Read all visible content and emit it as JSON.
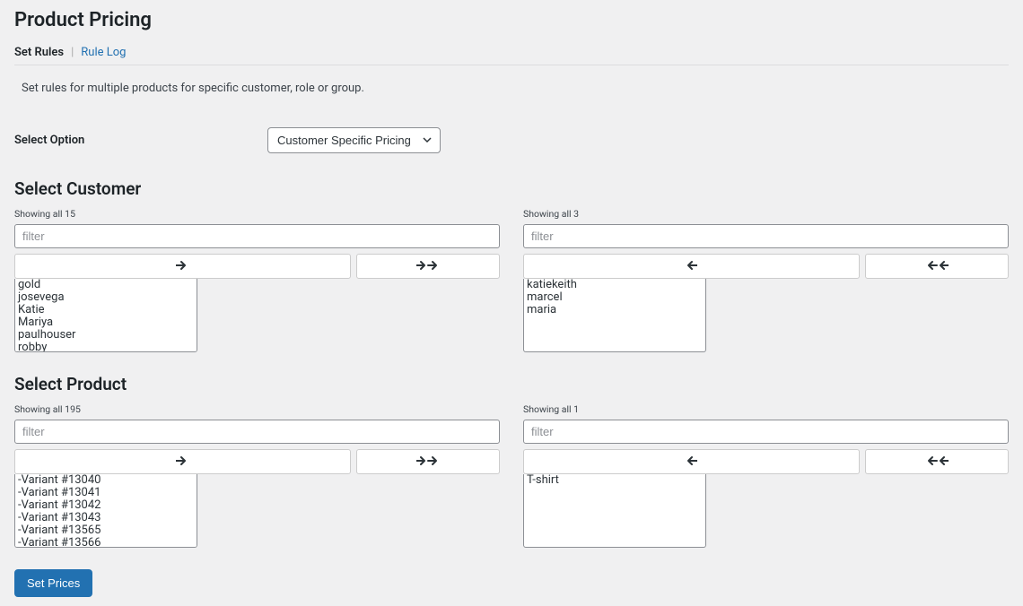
{
  "header": {
    "title": "Product Pricing"
  },
  "tabs": {
    "active": "Set Rules",
    "separator": "|",
    "other": "Rule Log"
  },
  "description": "Set rules for multiple products for specific customer, role or group.",
  "optionRow": {
    "label": "Select Option",
    "selected": "Customer Specific Pricing"
  },
  "customerSection": {
    "title": "Select Customer",
    "left": {
      "showing": "Showing all 15",
      "filterPlaceholder": "filter",
      "items": [
        "gold",
        "josevega",
        "Katie",
        "Mariya",
        "paulhouser",
        "robby"
      ]
    },
    "right": {
      "showing": "Showing all 3",
      "filterPlaceholder": "filter",
      "items": [
        "katiekeith",
        "marcel",
        "maria"
      ]
    }
  },
  "productSection": {
    "title": "Select Product",
    "left": {
      "showing": "Showing all 195",
      "filterPlaceholder": "filter",
      "items": [
        "-Variant #13040",
        "-Variant #13041",
        "-Variant #13042",
        "-Variant #13043",
        "-Variant #13565",
        "-Variant #13566"
      ]
    },
    "right": {
      "showing": "Showing all 1",
      "filterPlaceholder": "filter",
      "items": [
        "T-shirt"
      ]
    }
  },
  "submit": {
    "label": "Set Prices"
  },
  "icons": {
    "arrowRight": "➔",
    "arrowLeft": "←",
    "arrowDoubleRight": "➔ ➔",
    "arrowDoubleLeft": "← ←",
    "caretDown": "⌄"
  }
}
